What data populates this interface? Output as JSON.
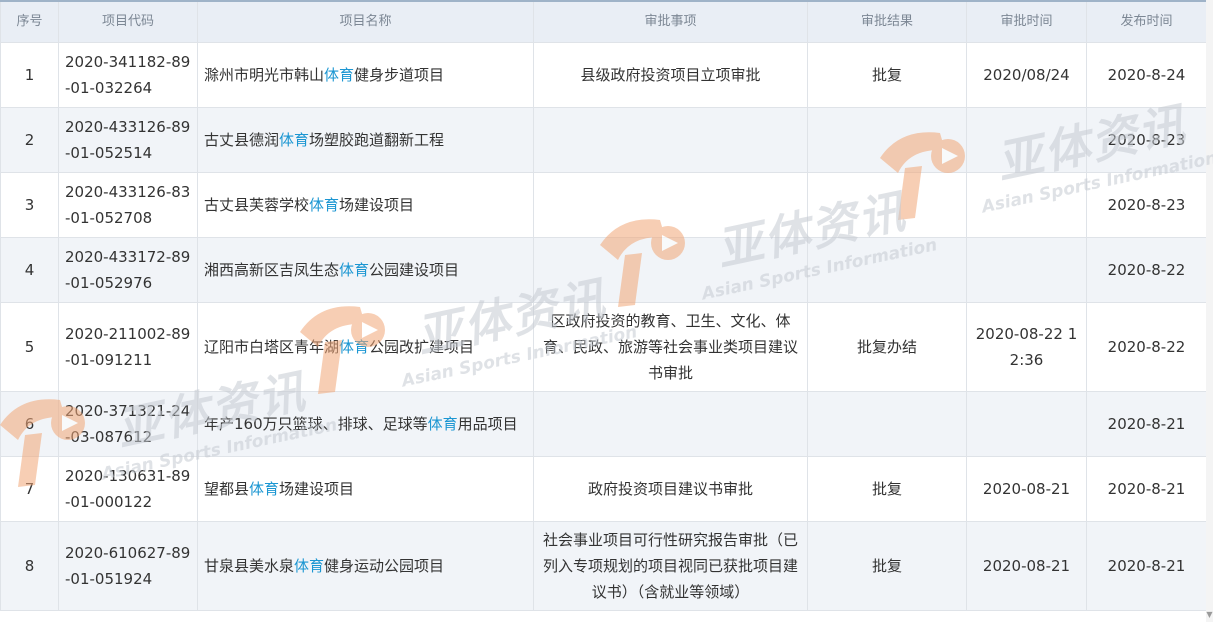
{
  "headers": [
    "序号",
    "项目代码",
    "项目名称",
    "审批事项",
    "审批结果",
    "审批时间",
    "发布时间"
  ],
  "highlight_word": "体育",
  "rows": [
    {
      "no": "1",
      "code": "2020-341182-89-01-032264",
      "name_pre": "滁州市明光市韩山",
      "name_hl": "体育",
      "name_post": "健身步道项目",
      "item": "县级政府投资项目立项审批",
      "result": "批复",
      "approve_time": "2020/08/24",
      "publish_time": "2020-8-24"
    },
    {
      "no": "2",
      "code": "2020-433126-89-01-052514",
      "name_pre": "古丈县德润",
      "name_hl": "体育",
      "name_post": "场塑胶跑道翻新工程",
      "item": "",
      "result": "",
      "approve_time": "",
      "publish_time": "2020-8-23"
    },
    {
      "no": "3",
      "code": "2020-433126-83-01-052708",
      "name_pre": "古丈县芙蓉学校",
      "name_hl": "体育",
      "name_post": "场建设项目",
      "item": "",
      "result": "",
      "approve_time": "",
      "publish_time": "2020-8-23"
    },
    {
      "no": "4",
      "code": "2020-433172-89-01-052976",
      "name_pre": "湘西高新区吉凤生态",
      "name_hl": "体育",
      "name_post": "公园建设项目",
      "item": "",
      "result": "",
      "approve_time": "",
      "publish_time": "2020-8-22"
    },
    {
      "no": "5",
      "code": "2020-211002-89-01-091211",
      "name_pre": "辽阳市白塔区青年湖",
      "name_hl": "体育",
      "name_post": "公园改扩建项目",
      "item": "区政府投资的教育、卫生、文化、体育、民政、旅游等社会事业类项目建议书审批",
      "result": "批复办结",
      "approve_time": "2020-08-22 12:36",
      "publish_time": "2020-8-22"
    },
    {
      "no": "6",
      "code": "2020-371321-24-03-087612",
      "name_pre": "年产160万只篮球、排球、足球等",
      "name_hl": "体育",
      "name_post": "用品项目",
      "item": "",
      "result": "",
      "approve_time": "",
      "publish_time": "2020-8-21"
    },
    {
      "no": "7",
      "code": "2020-130631-89-01-000122",
      "name_pre": "望都县",
      "name_hl": "体育",
      "name_post": "场建设项目",
      "item": "政府投资项目建议书审批",
      "result": "批复",
      "approve_time": "2020-08-21",
      "publish_time": "2020-8-21"
    },
    {
      "no": "8",
      "code": "2020-610627-89-01-051924",
      "name_pre": "甘泉县美水泉",
      "name_hl": "体育",
      "name_post": "健身运动公园项目",
      "item": "社会事业项目可行性研究报告审批（已列入专项规划的项目视同已获批项目建议书）（含就业等领域）",
      "result": "批复",
      "approve_time": "2020-08-21",
      "publish_time": "2020-8-21"
    }
  ],
  "watermark": {
    "brand": "亚体资讯",
    "sub": "Asian Sports Information"
  },
  "colors": {
    "highlight": "#1b96d2",
    "header_bg": "#e9eef5",
    "alt_row": "#f1f4f8",
    "watermark_orange": "#f2a777"
  }
}
